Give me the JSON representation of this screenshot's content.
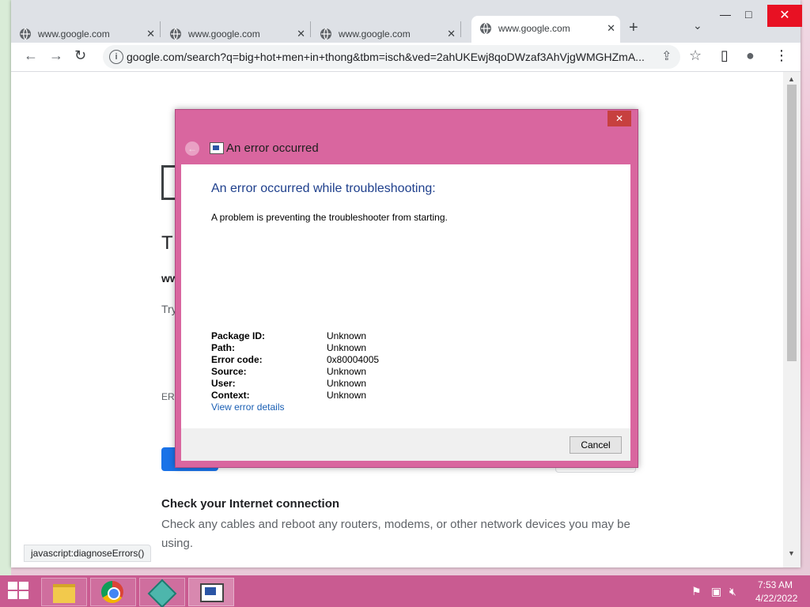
{
  "browser": {
    "tabs": [
      {
        "title": "www.google.com",
        "active": false
      },
      {
        "title": "www.google.com",
        "active": false
      },
      {
        "title": "www.google.com",
        "active": false
      },
      {
        "title": "www.google.com",
        "active": true
      }
    ],
    "new_tab_icon": "plus-icon",
    "window_controls": {
      "minimize": "—",
      "maximize": "□",
      "close": "✕"
    },
    "url": "google.com/search?q=big+hot+men+in+thong&tbm=isch&ved=2ahUKEwj8qoDWzaf3AhVjgWMGHZmA..."
  },
  "page": {
    "partial_heading": "T",
    "partial_bold": "ww",
    "partial_try": "Try",
    "partial_err": "ER",
    "check_heading": "Check your Internet connection",
    "check_body": "Check any cables and reboot any routers, modems, or other network devices you may be using.",
    "status_url": "javascript:diagnoseErrors()"
  },
  "dialog": {
    "window_title": "An error occurred",
    "close_label": "✕",
    "heading": "An error occurred while troubleshooting:",
    "description": "A problem is preventing the troubleshooter from starting.",
    "details": [
      {
        "label": "Package ID:",
        "value": "Unknown"
      },
      {
        "label": "Path:",
        "value": "Unknown"
      },
      {
        "label": "Error code:",
        "value": "0x80004005"
      },
      {
        "label": "Source:",
        "value": "Unknown"
      },
      {
        "label": "User:",
        "value": "Unknown"
      },
      {
        "label": "Context:",
        "value": "Unknown"
      }
    ],
    "link": "View error details",
    "cancel_label": "Cancel"
  },
  "taskbar": {
    "clock_time": "7:53 AM",
    "clock_date": "4/22/2022",
    "accent": "#c95b91"
  }
}
